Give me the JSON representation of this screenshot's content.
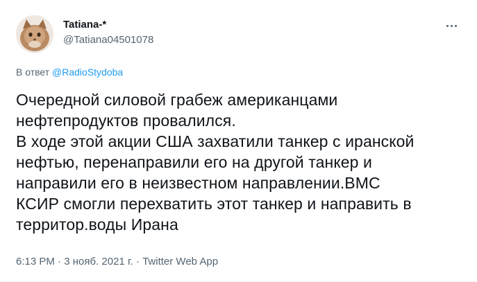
{
  "author": {
    "display_name": "Tatiana-*",
    "handle": "@Tatiana04501078"
  },
  "reply": {
    "prefix": "В ответ ",
    "mention": "@RadioStydoba"
  },
  "tweet": {
    "text": "Очередной силовой грабеж американцами\nнефтепродуктов провалился.\nВ ходе этой акции США захватили танкер с иранской\nнефтью, перенаправили его на другой танкер и\nнаправили его в неизвестном направлении.ВМС\nКСИР смогли перехватить этот танкер и направить в\nтерритор.воды Ирана"
  },
  "meta": {
    "time": "6:13 PM",
    "separator": " · ",
    "date": "3 нояб. 2021 г.",
    "source": "Twitter Web App"
  },
  "icons": {
    "more": "more-horizontal-icon"
  },
  "colors": {
    "link": "#1d9bf0",
    "secondary": "#536471",
    "text": "#0f1419"
  }
}
